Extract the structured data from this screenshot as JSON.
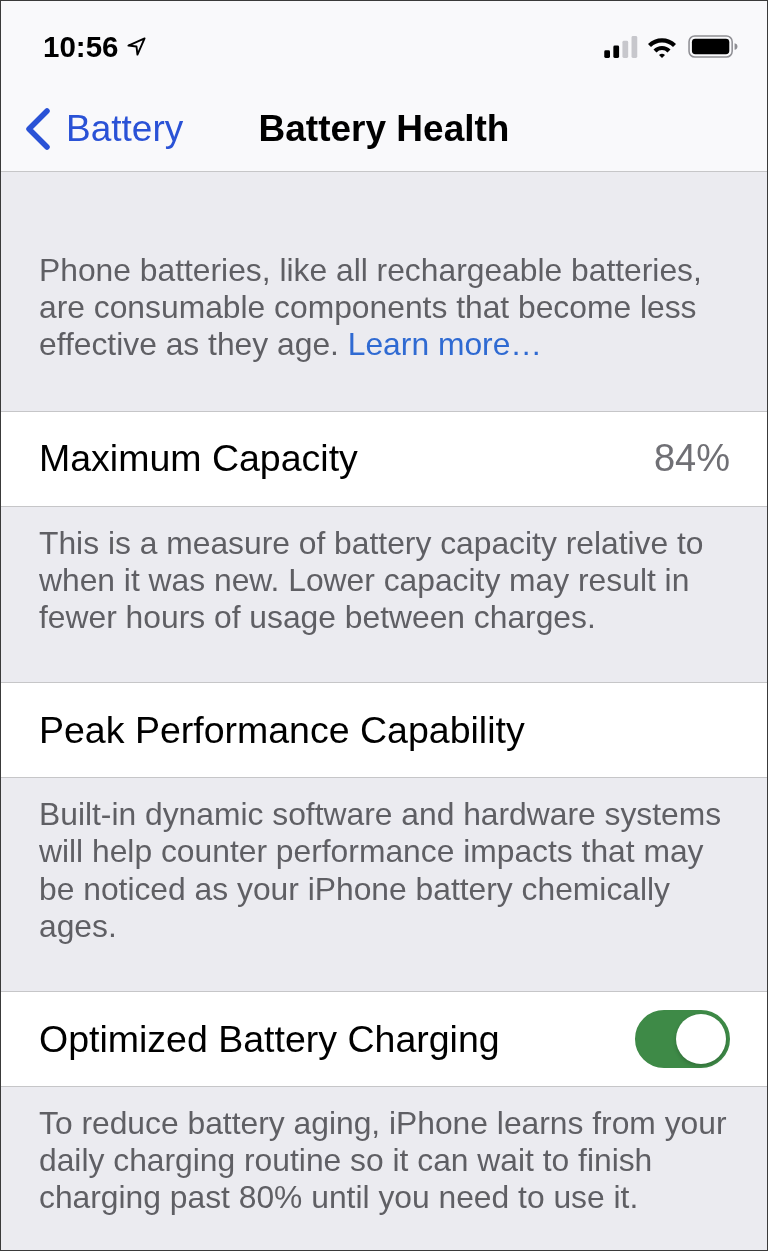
{
  "status_bar": {
    "time": "10:56"
  },
  "nav_bar": {
    "back_label": "Battery",
    "title": "Battery Health"
  },
  "intro": {
    "text": "Phone batteries, like all rechargeable batteries, are consumable components that become less effective as they age.",
    "link": "Learn more…"
  },
  "settings": [
    {
      "kind": "value",
      "label": "Maximum Capacity",
      "value": "84%",
      "footer": "This is a measure of battery capacity relative to when it was new. Lower capacity may result in fewer hours of usage between charges."
    },
    {
      "kind": "plain",
      "label": "Peak Performance Capability",
      "footer": "Built-in dynamic software and hardware systems will help counter performance impacts that may be noticed as your iPhone battery chemically ages."
    },
    {
      "kind": "toggle",
      "label": "Optimized Battery Charging",
      "on": true,
      "footer": "To reduce battery aging, iPhone learns from your daily charging routine so it can wait to finish charging past 80% until you need to use it."
    }
  ]
}
